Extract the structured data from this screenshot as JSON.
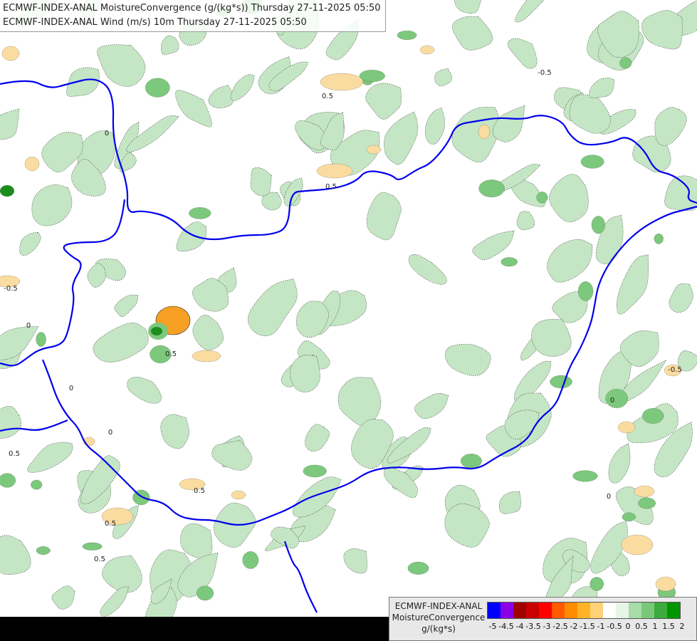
{
  "header": {
    "line1": "ECMWF-INDEX-ANAL MoistureConvergence (g/(kg*s)) Thursday 27-11-2025 05:50",
    "line2": "ECMWF-INDEX-ANAL Wind (m/s) 10m Thursday 27-11-2025 05:50"
  },
  "legend": {
    "title_line1": "ECMWF-INDEX-ANAL",
    "title_line2": "MoistureConvergence",
    "title_line3": "g/(kg*s)",
    "tick_labels": [
      "-5",
      "-4.5",
      "-4",
      "-3.5",
      "-3",
      "-2.5",
      "-2",
      "-1.5",
      "-1",
      "-0.5",
      "0",
      "0.5",
      "1",
      "1.5",
      "2"
    ],
    "colors": [
      "#0000ff",
      "#8a00e6",
      "#a00000",
      "#c80000",
      "#ff0000",
      "#ff5a00",
      "#ff8c00",
      "#ffb428",
      "#ffd278",
      "#ffffff",
      "#e6f5e6",
      "#a8dca8",
      "#78c878",
      "#3caa3c",
      "#009600"
    ]
  },
  "map": {
    "land_color": "#ffffff",
    "conv_light_color": "#c4e6c4",
    "conv_mid_color": "#7cc87c",
    "conv_strong_color": "#1e8c1e",
    "div_light_color": "#fadca0",
    "div_mid_color": "#f5a023",
    "border_color": "#0000ee",
    "river_color": "#3a6ee6",
    "streamline_color": "#000000",
    "contour_labels": [
      "0",
      "0",
      "0",
      "0",
      "0",
      "-0.5",
      "-0.5",
      "-0.5",
      "0.5",
      "0.5",
      "0.5",
      "0.5",
      "0.5",
      "0.5",
      "0.5",
      "0"
    ]
  }
}
